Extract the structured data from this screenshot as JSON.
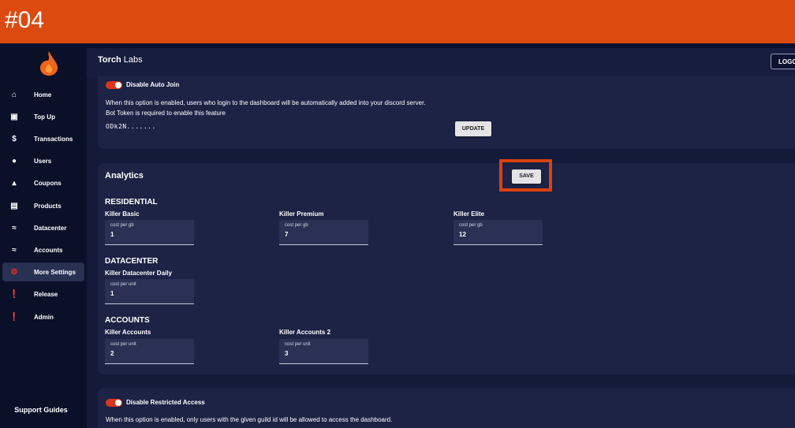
{
  "banner": {
    "text": "#04"
  },
  "colors": {
    "accent": "#dc4a10",
    "toggle_on": "#d9351e",
    "background": "#131a3a",
    "panel": "#1c2345"
  },
  "sidebar": {
    "items": [
      {
        "label": "Home",
        "icon": "home-icon"
      },
      {
        "label": "Top Up",
        "icon": "wallet-icon"
      },
      {
        "label": "Transactions",
        "icon": "dollar-icon"
      },
      {
        "label": "Users",
        "icon": "user-icon"
      },
      {
        "label": "Coupons",
        "icon": "coupon-icon"
      },
      {
        "label": "Products",
        "icon": "briefcase-icon"
      },
      {
        "label": "Datacenter",
        "icon": "wifi-icon"
      },
      {
        "label": "Accounts",
        "icon": "wifi-icon"
      },
      {
        "label": "More Settings",
        "icon": "gear-icon",
        "active": true
      },
      {
        "label": "Release",
        "icon": "alert-icon"
      },
      {
        "label": "Admin",
        "icon": "alert-icon"
      }
    ],
    "support": "Support Guides"
  },
  "topbar": {
    "brand_bold": "Torch",
    "brand_rest": " Labs",
    "logout_label": "LOGOUT"
  },
  "auto_join": {
    "toggle_label": "Disable Auto Join",
    "desc1": "When this option is enabled, users who login to the dashboard will be automatically added into your discord server.",
    "desc2": "Bot Token is required to enable this feature",
    "token": "ODk2N.......",
    "update_label": "UPDATE"
  },
  "analytics": {
    "title": "Analytics",
    "save_label": "SAVE",
    "residential": {
      "title": "RESIDENTIAL",
      "items": [
        {
          "name": "Killer Basic",
          "field_label": "cost per gb",
          "value": "1"
        },
        {
          "name": "Killer Premium",
          "field_label": "cost per gb",
          "value": "7"
        },
        {
          "name": "Killer Elite",
          "field_label": "cost per gb",
          "value": "12"
        }
      ]
    },
    "datacenter": {
      "title": "DATACENTER",
      "items": [
        {
          "name": "Killer Datacenter Daily",
          "field_label": "cost per unit",
          "value": "1"
        }
      ]
    },
    "accounts": {
      "title": "ACCOUNTS",
      "items": [
        {
          "name": "Killer Accounts",
          "field_label": "cost per unit",
          "value": "2"
        },
        {
          "name": "Killer Accounts 2",
          "field_label": "cost per unit",
          "value": "3"
        }
      ]
    }
  },
  "restricted": {
    "toggle_label": "Disable Restricted Access",
    "desc": "When this option is enabled, only users with the given guild id will be allowed to access the dashboard."
  }
}
